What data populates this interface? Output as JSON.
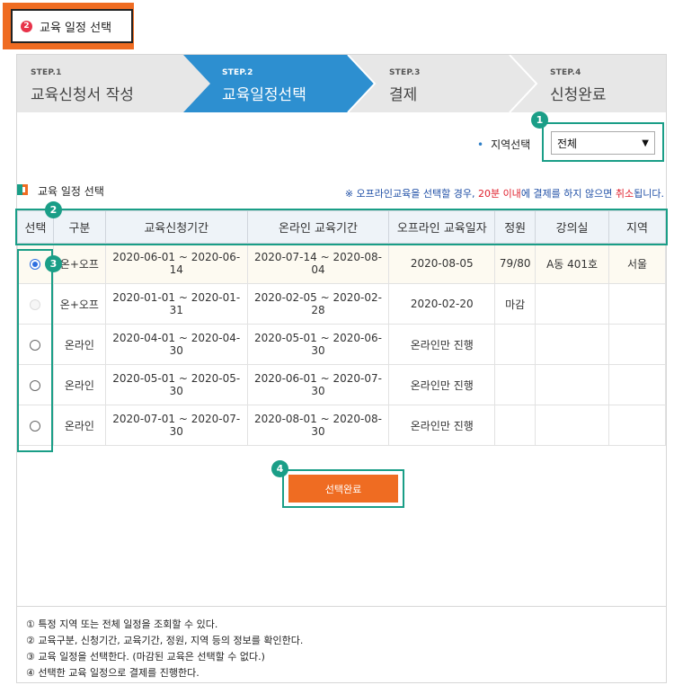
{
  "header": {
    "badge_num": "2",
    "title": "교육 일정 선택"
  },
  "steps": [
    {
      "label": "STEP.1",
      "title": "교육신청서 작성",
      "active": false
    },
    {
      "label": "STEP.2",
      "title": "교육일정선택",
      "active": true
    },
    {
      "label": "STEP.3",
      "title": "결제",
      "active": false
    },
    {
      "label": "STEP.4",
      "title": "신청완료",
      "active": false
    }
  ],
  "region": {
    "label": "지역선택",
    "selected": "전체",
    "options": [
      "전체"
    ]
  },
  "section": {
    "title": "교육 일정 선택",
    "notice_a": "※ 오프라인교육을 선택할 경우, ",
    "notice_b": "20분 이내",
    "notice_c": "에 결제를 하지 않으면 ",
    "notice_d": "취소",
    "notice_e": "됩니다."
  },
  "table": {
    "columns": [
      "선택",
      "구분",
      "교육신청기간",
      "온라인 교육기간",
      "오프라인 교육일자",
      "정원",
      "강의실",
      "지역"
    ],
    "rows": [
      {
        "selected": true,
        "disabled": false,
        "type": "온+오프",
        "apply": "2020-06-01 ~ 2020-06-14",
        "online": "2020-07-14 ~ 2020-08-04",
        "offline": "2020-08-05",
        "capacity": "79/80",
        "room": "A동 401호",
        "region": "서울"
      },
      {
        "selected": false,
        "disabled": true,
        "type": "온+오프",
        "apply": "2020-01-01 ~ 2020-01-31",
        "online": "2020-02-05 ~ 2020-02-28",
        "offline": "2020-02-20",
        "capacity": "마감",
        "room": "",
        "region": ""
      },
      {
        "selected": false,
        "disabled": false,
        "type": "온라인",
        "apply": "2020-04-01 ~ 2020-04-30",
        "online": "2020-05-01 ~ 2020-06-30",
        "offline": "온라인만 진행",
        "capacity": "",
        "room": "",
        "region": ""
      },
      {
        "selected": false,
        "disabled": false,
        "type": "온라인",
        "apply": "2020-05-01 ~ 2020-05-30",
        "online": "2020-06-01 ~ 2020-07-30",
        "offline": "온라인만 진행",
        "capacity": "",
        "room": "",
        "region": ""
      },
      {
        "selected": false,
        "disabled": false,
        "type": "온라인",
        "apply": "2020-07-01 ~ 2020-07-30",
        "online": "2020-08-01 ~ 2020-08-30",
        "offline": "온라인만 진행",
        "capacity": "",
        "room": "",
        "region": ""
      }
    ]
  },
  "submit_label": "선택완료",
  "callouts": [
    "1",
    "2",
    "3",
    "4"
  ],
  "notes": [
    "① 특정 지역 또는 전체 일정을 조회할 수 있다.",
    "② 교육구분, 신청기간, 교육기간, 정원, 지역 등의 정보를 확인한다.",
    "③ 교육 일정을 선택한다. (마감된 교육은 선택할 수 없다.)",
    "④ 선택한 교육 일정으로 결제를 진행한다."
  ],
  "colors": {
    "accent": "#ef6c22",
    "teal": "#1a9e87",
    "step_active": "#2d8fd0",
    "notice_blue": "#1f4fa6",
    "notice_red": "#e0212e"
  }
}
